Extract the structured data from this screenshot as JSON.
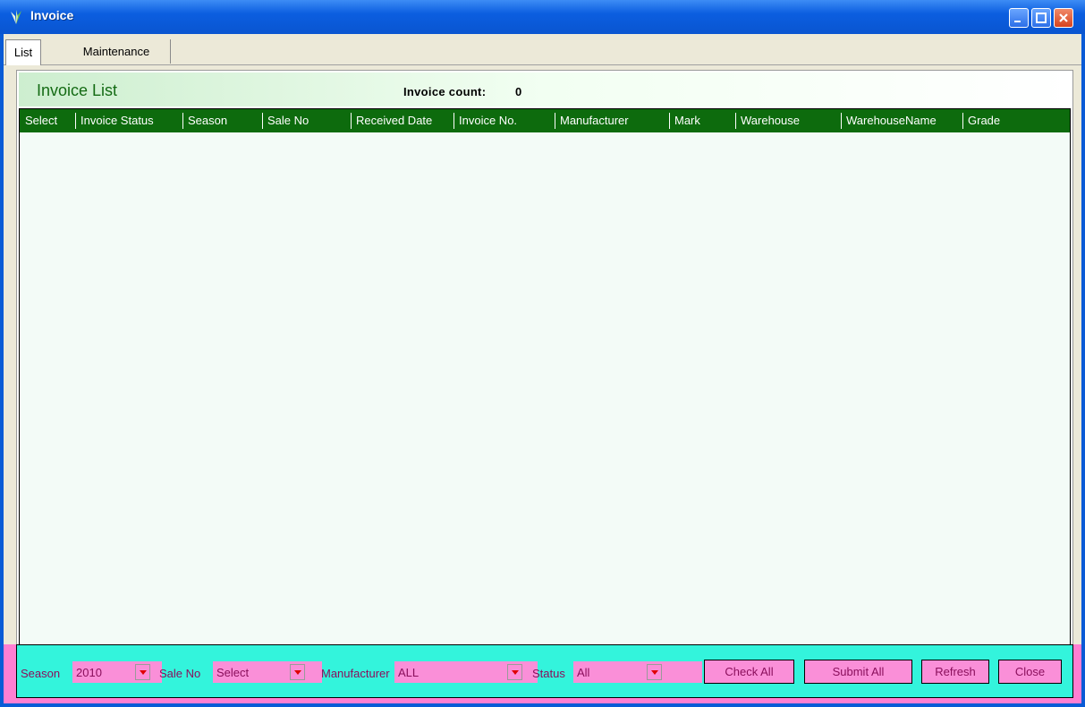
{
  "window": {
    "title": "Invoice",
    "controls": [
      "minimize-icon",
      "maximize-icon",
      "close-icon"
    ]
  },
  "tabs": [
    {
      "label": "List",
      "active": true
    },
    {
      "label": "Maintenance",
      "active": false
    }
  ],
  "list": {
    "title": "Invoice List",
    "count_label": "Invoice count:",
    "count_value": "0"
  },
  "grid": {
    "columns": [
      "Select",
      "Invoice Status",
      "Season",
      "Sale No",
      "Received Date",
      "Invoice No.",
      "Manufacturer",
      "Mark",
      "Warehouse",
      "WarehouseName",
      "Grade"
    ],
    "rows": []
  },
  "filters": {
    "season_label": "Season",
    "season_value": "2010",
    "sale_no_label": "Sale No",
    "sale_no_value": "Select",
    "manufacturer_label": "Manufacturer",
    "manufacturer_value": "ALL",
    "status_label": "Status",
    "status_value": "All"
  },
  "buttons": {
    "check_all": "Check All",
    "submit_all": "Submit All",
    "refresh": "Refresh",
    "close": "Close"
  },
  "colors": {
    "header_green": "#0d6b0d",
    "title_green": "#146b14",
    "footer_cyan": "#33f4dc",
    "footer_pink": "#fa8fd8"
  }
}
